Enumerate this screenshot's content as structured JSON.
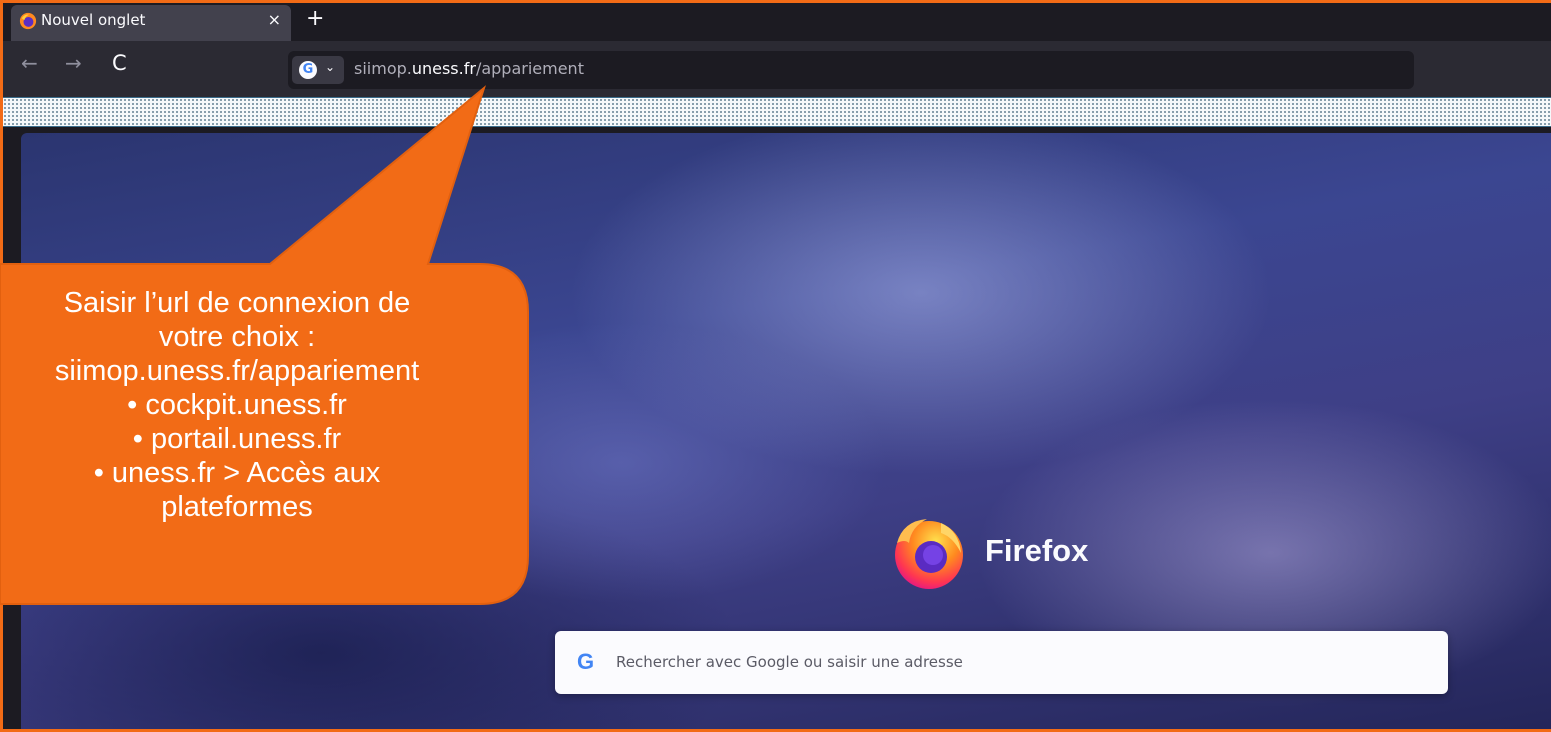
{
  "browser": {
    "tab": {
      "title": "Nouvel onglet",
      "close_glyph": "×",
      "favicon": "firefox-icon"
    },
    "new_tab_glyph": "+",
    "nav": {
      "back_glyph": "←",
      "forward_glyph": "→",
      "reload_glyph": "C"
    },
    "urlbar": {
      "engine_badge": "G",
      "chevron": "⌄",
      "url_prefix": "siimop.",
      "url_domain": "uness.fr",
      "url_path": "/appariement"
    }
  },
  "newtab": {
    "brand": "Firefox",
    "search": {
      "engine_glyph": "G",
      "placeholder": "Rechercher avec Google ou saisir une adresse"
    }
  },
  "callout": {
    "lines": [
      "Saisir l’url de connexion de",
      "votre choix :",
      "siimop.uness.fr/appariement",
      "• cockpit.uness.fr",
      "• portail.uness.fr",
      "• uness.fr > Accès aux",
      "plateformes"
    ],
    "color": "#f26b16"
  },
  "colors": {
    "accent_border": "#f26b16",
    "toolbar": "#2b2a33",
    "tabstrip": "#1c1b22"
  }
}
